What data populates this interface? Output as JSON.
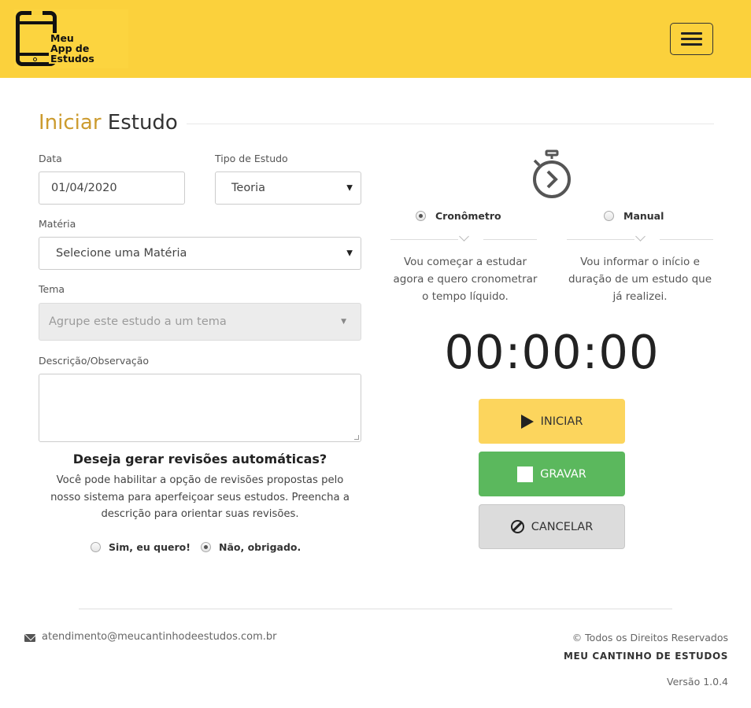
{
  "header": {
    "logo_lines": [
      "Meu",
      "App de",
      "Estudos"
    ],
    "menu_icon": "hamburger-icon"
  },
  "title": {
    "part1": "Iniciar",
    "part2": "Estudo"
  },
  "form": {
    "date_label": "Data",
    "date_value": "01/04/2020",
    "type_label": "Tipo de Estudo",
    "type_value": "Teoria",
    "subject_label": "Matéria",
    "subject_value": "Selecione uma Matéria",
    "topic_label": "Tema",
    "topic_placeholder": "Agrupe este estudo a um tema",
    "description_label": "Descrição/Observação",
    "description_value": ""
  },
  "revisions": {
    "title": "Deseja gerar revisões automáticas?",
    "text": "Você pode habilitar a opção de revisões propostas pelo nosso sistema para aperfeiçoar seus estudos. Preencha a descrição para orientar suas revisões.",
    "option_yes": "Sim, eu quero!",
    "option_no": "Não, obrigado.",
    "selected": "no"
  },
  "modes": {
    "icon": "stopwatch-icon",
    "cronometro": {
      "label": "Cronômetro",
      "desc": "Vou começar a estudar agora e quero cronometrar o tempo líquido."
    },
    "manual": {
      "label": "Manual",
      "desc": "Vou informar o início e duração de um estudo que já realizei."
    },
    "selected": "cronometro"
  },
  "timer": "00:00:00",
  "buttons": {
    "start": "INICIAR",
    "save": "GRAVAR",
    "cancel": "CANCELAR"
  },
  "footer": {
    "email": "atendimento@meucantinhodeestudos.com.br",
    "rights": "© Todos os Direitos Reservados",
    "brand": "MEU CANTINHO DE ESTUDOS",
    "version": "Versão 1.0.4"
  },
  "colors": {
    "header": "#fbd13c",
    "title_accent": "#cc9b2e",
    "start_button": "#fcd55d",
    "save_button": "#5bb85d",
    "cancel_button": "#dcdcdc"
  }
}
